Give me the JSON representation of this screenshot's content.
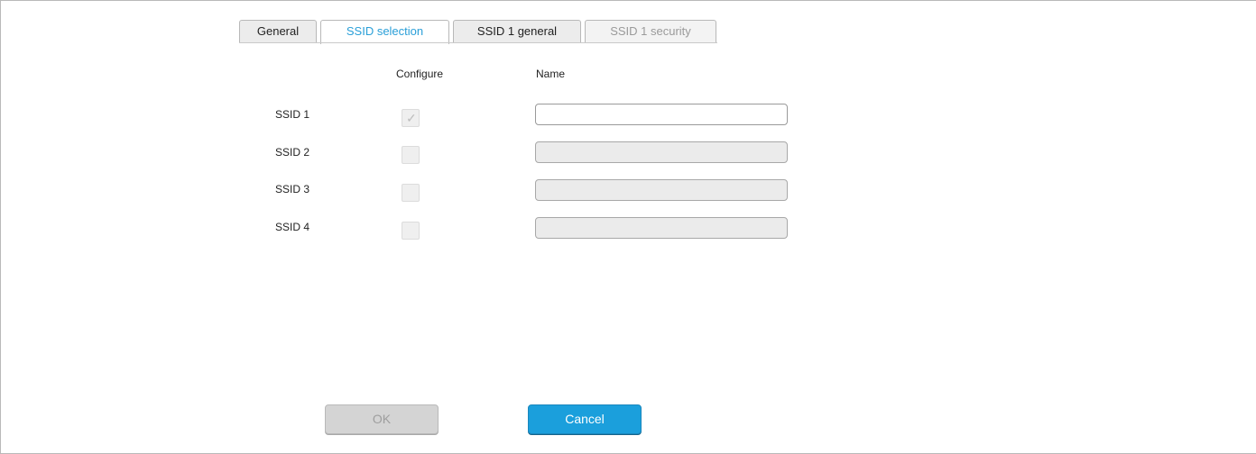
{
  "tabs": [
    {
      "label": "General",
      "state": "normal"
    },
    {
      "label": "SSID selection",
      "state": "active"
    },
    {
      "label": "SSID 1 general",
      "state": "normal"
    },
    {
      "label": "SSID 1 security",
      "state": "disabled"
    }
  ],
  "columns": {
    "configure": "Configure",
    "name": "Name"
  },
  "rows": [
    {
      "label": "SSID 1",
      "configure_checked": true,
      "configure_enabled": false,
      "name_value": "",
      "name_enabled": true
    },
    {
      "label": "SSID 2",
      "configure_checked": false,
      "configure_enabled": false,
      "name_value": "",
      "name_enabled": false
    },
    {
      "label": "SSID 3",
      "configure_checked": false,
      "configure_enabled": false,
      "name_value": "",
      "name_enabled": false
    },
    {
      "label": "SSID 4",
      "configure_checked": false,
      "configure_enabled": false,
      "name_value": "",
      "name_enabled": false
    }
  ],
  "buttons": {
    "ok": "OK",
    "cancel": "Cancel"
  },
  "colors": {
    "accent": "#1b9fdc",
    "active_tab_text": "#2a9fd8",
    "disabled_text": "#9e9e9e"
  }
}
